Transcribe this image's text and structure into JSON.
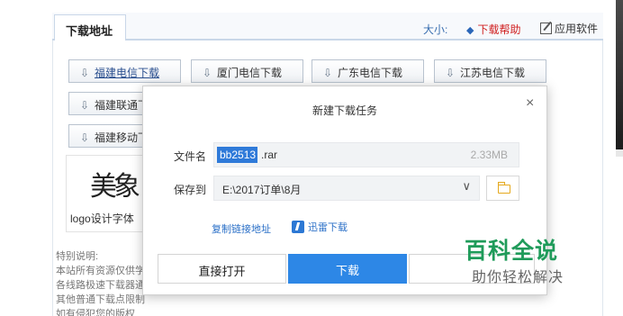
{
  "page": {
    "tab_label": "下载地址",
    "size_label": "大小:",
    "help_label": "下载帮助",
    "app_label": "应用软件"
  },
  "download_buttons": [
    {
      "label": "福建电信下载"
    },
    {
      "label": "厦门电信下载"
    },
    {
      "label": "广东电信下载"
    },
    {
      "label": "江苏电信下载"
    },
    {
      "label": "福建联通下载"
    },
    {
      "label": "福建移动下载"
    }
  ],
  "logo": {
    "art_text": "美象",
    "caption": "logo设计字体"
  },
  "notes": [
    "特别说明:",
    "本站所有资源仅供学",
    "各线路极速下载器通",
    "其他普通下载点限制",
    "如有侵犯您的版权"
  ],
  "dialog": {
    "title": "新建下载任务",
    "close_label": "×",
    "filename_label": "文件名",
    "filename_selected": "bb2513",
    "filename_ext": ".rar",
    "file_size": "2.33MB",
    "saveto_label": "保存到",
    "saveto_path": "E:\\2017订单\\8月",
    "dropdown_chevron": "∨",
    "copy_link_label": "复制链接地址",
    "thunder_label": "迅雷下载",
    "open_button": "直接打开",
    "download_button": "下载"
  },
  "watermark": {
    "main": "百科全说",
    "sub": "助你轻松解决"
  },
  "icons": {
    "download_arrow": "arrow-down-circle-icon",
    "help": "diamond-icon",
    "app": "edit-icon",
    "folder": "folder-icon",
    "thunder": "thunder-icon"
  },
  "colors": {
    "accent_blue": "#2d87e6",
    "selection": "#2f7ad9",
    "help_red": "#d02020",
    "watermark_green": "#1f9b5a"
  }
}
